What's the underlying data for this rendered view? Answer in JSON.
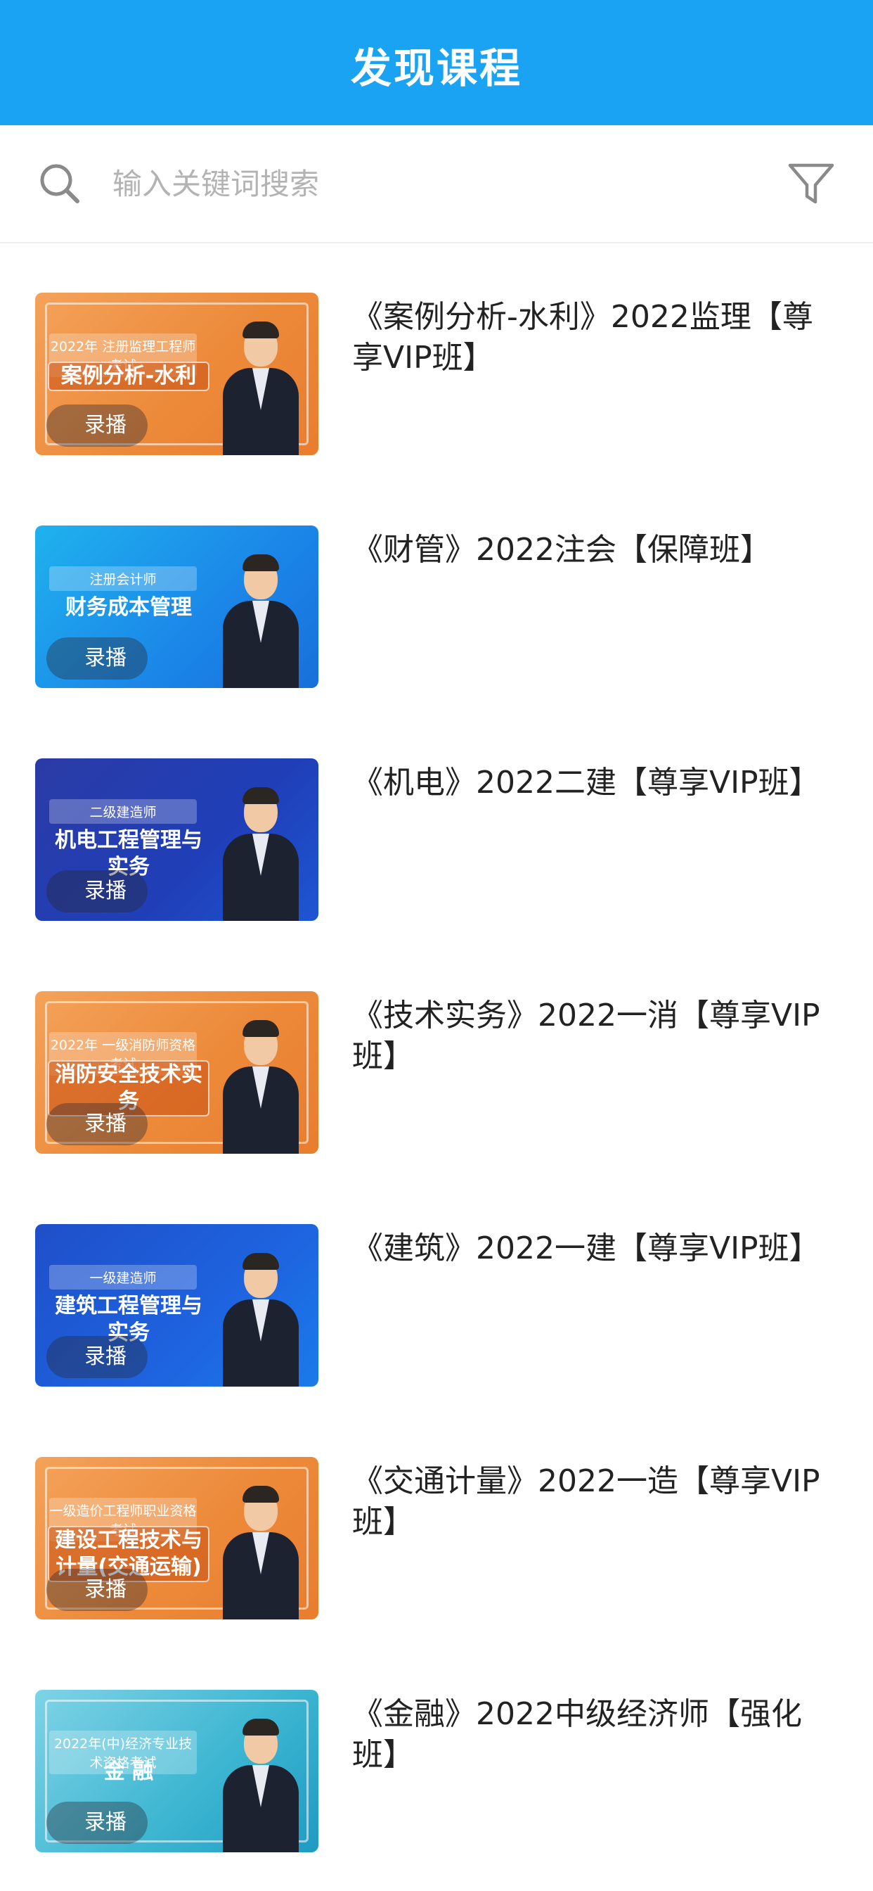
{
  "header": {
    "title": "发现课程"
  },
  "search": {
    "placeholder": "输入关键词搜索"
  },
  "courses": [
    {
      "title": "《案例分析-水利》2022监理【尊享VIP班】",
      "thumb_cert": "2022年 注册监理工程师考试",
      "thumb_subject": "案例分析-水利",
      "badge": "录播"
    },
    {
      "title": "《财管》2022注会【保障班】",
      "thumb_cert": "注册会计师",
      "thumb_subject": "财务成本管理",
      "badge": "录播"
    },
    {
      "title": "《机电》2022二建【尊享VIP班】",
      "thumb_cert": "二级建造师",
      "thumb_subject": "机电工程管理与实务",
      "badge": "录播"
    },
    {
      "title": "《技术实务》2022一消【尊享VIP班】",
      "thumb_cert": "2022年 一级消防师资格考试",
      "thumb_subject": "消防安全技术实务",
      "badge": "录播"
    },
    {
      "title": "《建筑》2022一建【尊享VIP班】",
      "thumb_cert": "一级建造师",
      "thumb_subject": "建筑工程管理与实务",
      "badge": "录播"
    },
    {
      "title": "《交通计量》2022一造【尊享VIP班】",
      "thumb_cert": "一级造价工程师职业资格考试",
      "thumb_subject": "建设工程技术与计量(交通运输)",
      "badge": "录播"
    },
    {
      "title": "《金融》2022中级经济师【强化班】",
      "thumb_cert": "2022年(中)经济专业技术资格考试",
      "thumb_subject": "金 融",
      "badge": "录播"
    }
  ]
}
